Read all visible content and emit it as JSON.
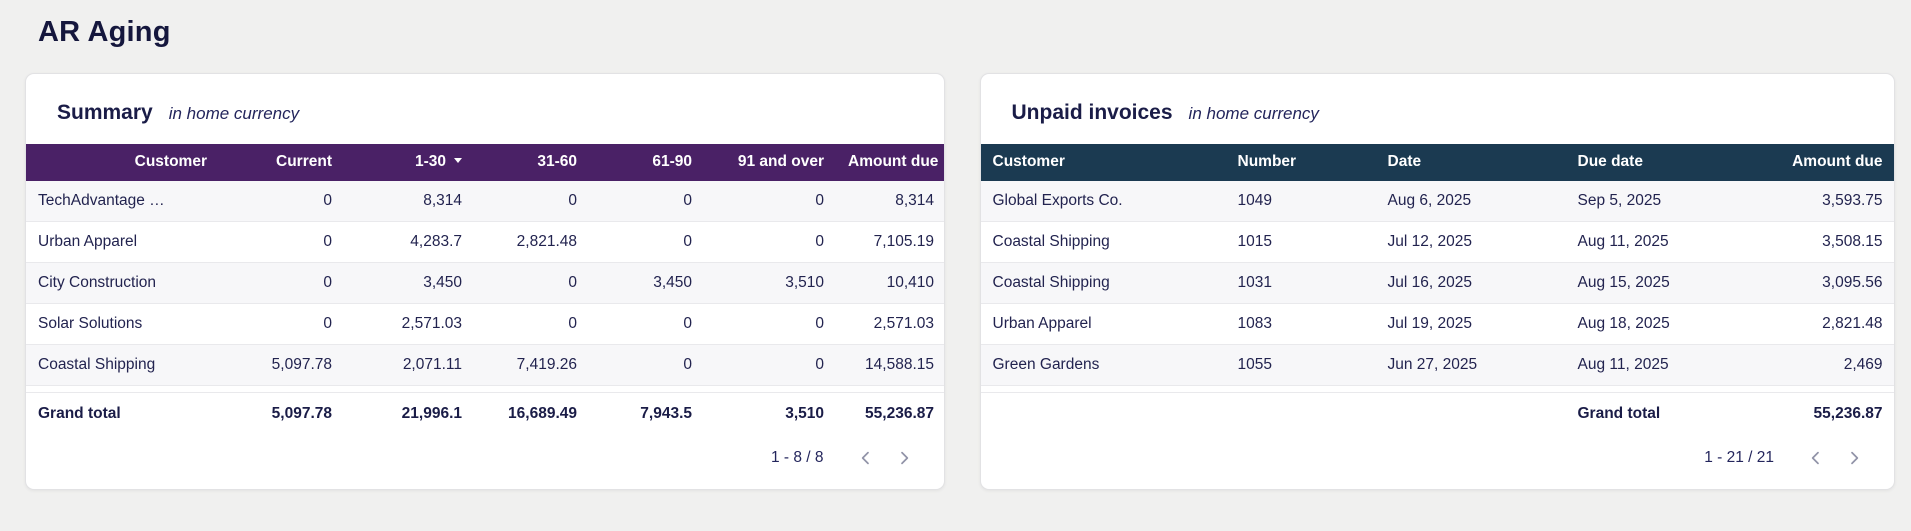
{
  "page": {
    "title": "AR Aging",
    "background_color": "#f0f0ef",
    "text_color": "#1f2150"
  },
  "summary_card": {
    "title": "Summary",
    "subtitle": "in home currency",
    "header_bg_color": "#4a2166",
    "columns": [
      {
        "label": "Customer"
      },
      {
        "label": "Current"
      },
      {
        "label": "1-30",
        "sort": "descending"
      },
      {
        "label": "31-60"
      },
      {
        "label": "61-90"
      },
      {
        "label": "91 and over"
      },
      {
        "label": "Amount due"
      }
    ],
    "rows": [
      [
        "TechAdvantage …",
        "0",
        "8,314",
        "0",
        "0",
        "0",
        "8,314"
      ],
      [
        "Urban Apparel",
        "0",
        "4,283.7",
        "2,821.48",
        "0",
        "0",
        "7,105.19"
      ],
      [
        "City Construction",
        "0",
        "3,450",
        "0",
        "3,450",
        "3,510",
        "10,410"
      ],
      [
        "Solar Solutions",
        "0",
        "2,571.03",
        "0",
        "0",
        "0",
        "2,571.03"
      ],
      [
        "Coastal Shipping",
        "5,097.78",
        "2,071.11",
        "7,419.26",
        "0",
        "0",
        "14,588.15"
      ]
    ],
    "grand_total": [
      "Grand total",
      "5,097.78",
      "21,996.1",
      "16,689.49",
      "7,943.5",
      "3,510",
      "55,236.87"
    ],
    "pagination": "1 - 8 / 8"
  },
  "unpaid_card": {
    "title": "Unpaid invoices",
    "subtitle": "in home currency",
    "header_bg_color": "#1b3a51",
    "columns": [
      {
        "label": "Customer"
      },
      {
        "label": "Number"
      },
      {
        "label": "Date"
      },
      {
        "label": "Due date"
      },
      {
        "label": "Amount due"
      }
    ],
    "rows": [
      [
        "Global Exports Co.",
        "1049",
        "Aug 6, 2025",
        "Sep 5, 2025",
        "3,593.75"
      ],
      [
        "Coastal Shipping",
        "1015",
        "Jul 12, 2025",
        "Aug 11, 2025",
        "3,508.15"
      ],
      [
        "Coastal Shipping",
        "1031",
        "Jul 16, 2025",
        "Aug 15, 2025",
        "3,095.56"
      ],
      [
        "Urban Apparel",
        "1083",
        "Jul 19, 2025",
        "Aug 18, 2025",
        "2,821.48"
      ],
      [
        "Green Gardens",
        "1055",
        "Jun 27, 2025",
        "Aug 11, 2025",
        "2,469"
      ]
    ],
    "grand_total_label": "Grand total",
    "grand_total_amount": "55,236.87",
    "pagination": "1 - 21 / 21"
  }
}
